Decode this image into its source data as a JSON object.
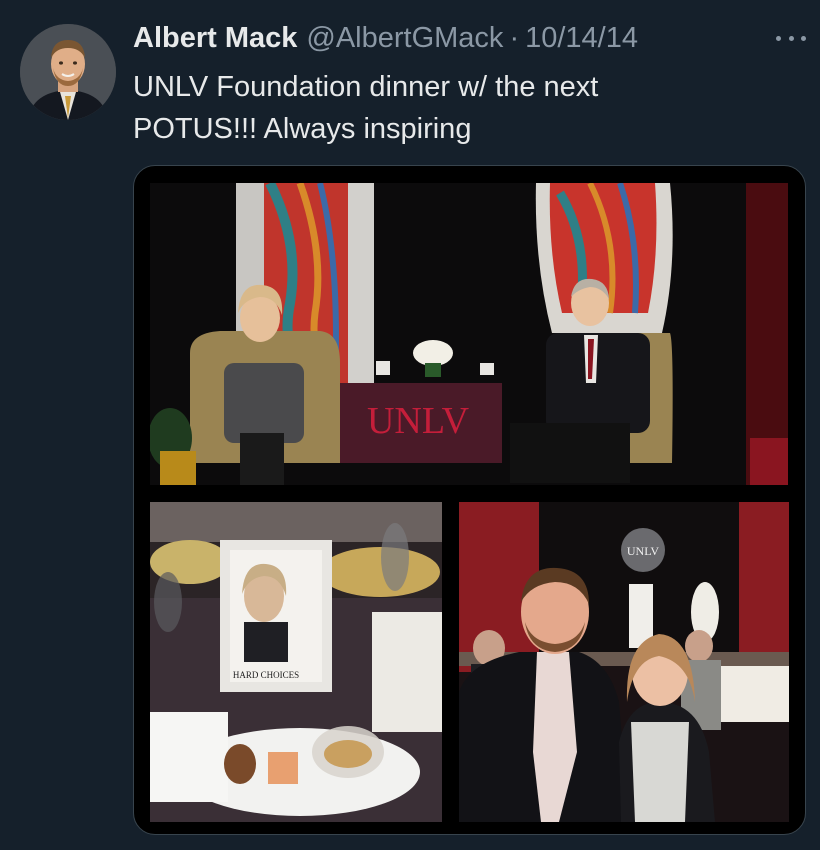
{
  "tweet": {
    "author_name": "Albert Mack",
    "handle": "@AlbertGMack",
    "separator": "·",
    "date": "10/14/14",
    "text_line1": "UNLV Foundation dinner w/ the next",
    "text_line2": "POTUS!!! Always inspiring"
  },
  "media": {
    "stage_banner_text": "UNLV",
    "logo_text": "UNLV",
    "book_cover_text": "HARD CHOICES"
  },
  "colors": {
    "background": "#15202b",
    "text_primary": "#e7e9ea",
    "text_secondary": "#8b98a5",
    "unlv_red": "#c41e3a"
  },
  "icons": {
    "more": "more-horizontal-icon"
  }
}
